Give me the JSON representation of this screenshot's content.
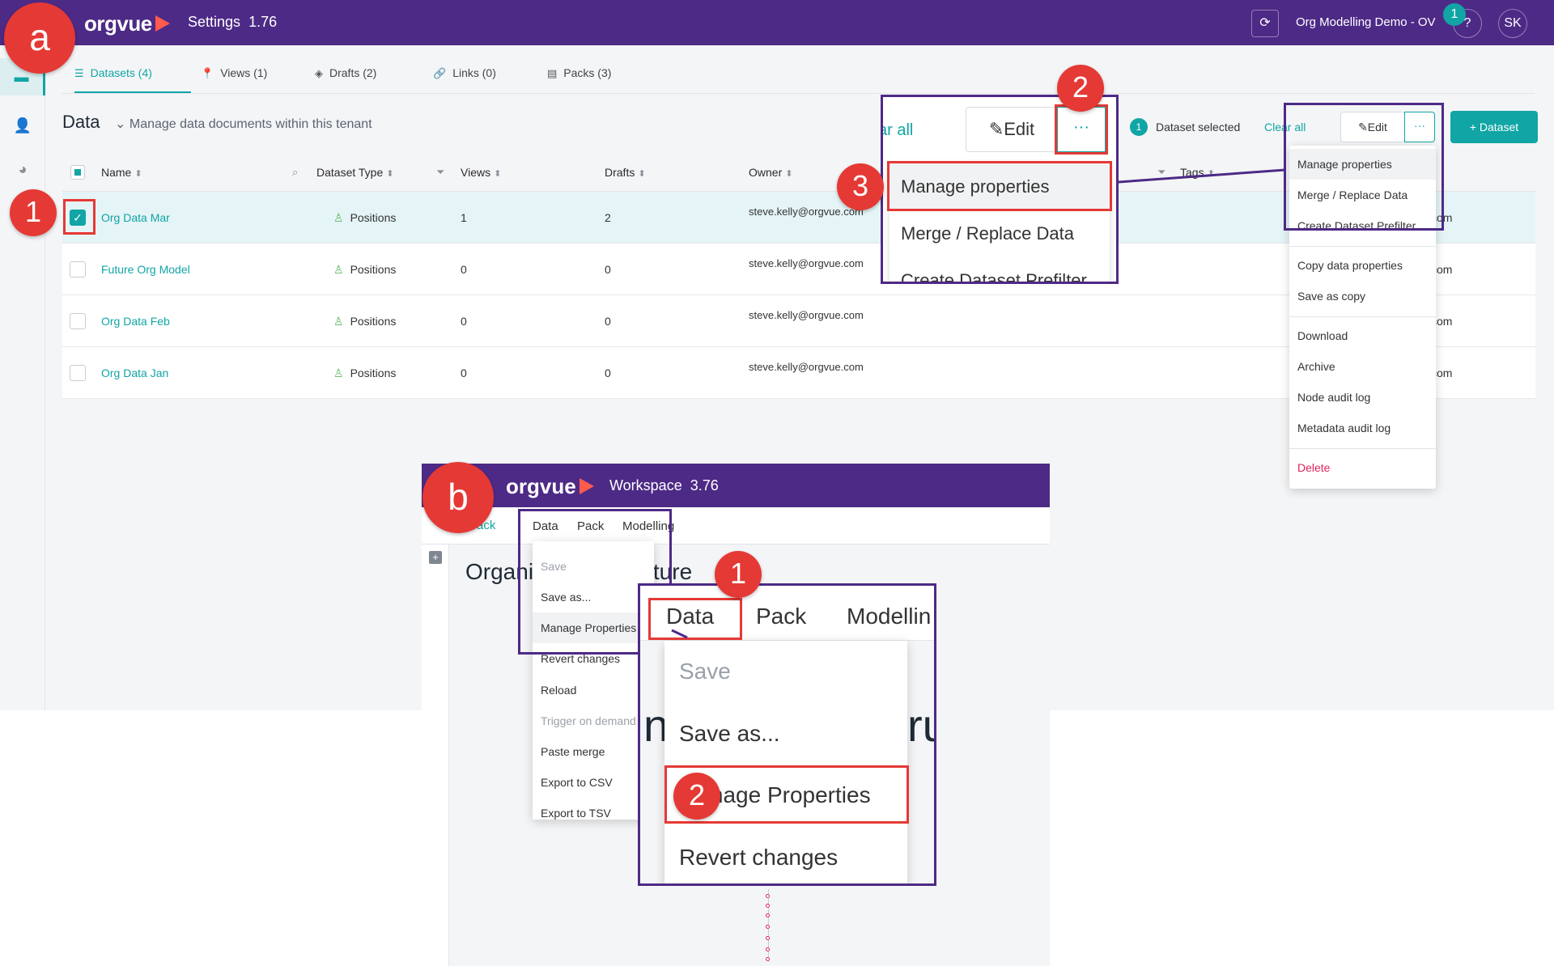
{
  "brand": {
    "name": "orgvue",
    "purple": "#4d2a86",
    "accent": "#11a5a5",
    "highlight": "#e53935"
  },
  "panel_a": {
    "app_title": "Settings",
    "version": "1.76",
    "org_name": "Org Modelling Demo - OV",
    "notification_count": "1",
    "help": "?",
    "avatar": "SK",
    "tabs": [
      {
        "label": "Datasets (4)",
        "icon": "database-icon"
      },
      {
        "label": "Views (1)",
        "icon": "pin-icon"
      },
      {
        "label": "Drafts (2)",
        "icon": "layers-icon"
      },
      {
        "label": "Links (0)",
        "icon": "link-icon"
      },
      {
        "label": "Packs (3)",
        "icon": "pack-icon"
      }
    ],
    "heading": "Data",
    "subheading": "Manage data documents within this tenant",
    "selection": {
      "count": "1",
      "text": "Dataset selected",
      "clear": "Clear all"
    },
    "edit_label": "Edit",
    "more_label": "···",
    "add_label": "+ Dataset",
    "columns": [
      "Name",
      "Dataset Type",
      "Views",
      "Drafts",
      "Owner",
      "Tags"
    ],
    "rows": [
      {
        "name": "Org Data Mar",
        "type": "Positions",
        "views": "1",
        "drafts": "2",
        "owner": "steve.kelly@orgvue.com",
        "tail": "com",
        "checked": true
      },
      {
        "name": "Future Org Model",
        "type": "Positions",
        "views": "0",
        "drafts": "0",
        "owner": "steve.kelly@orgvue.com",
        "tail": "com",
        "checked": false
      },
      {
        "name": "Org Data Feb",
        "type": "Positions",
        "views": "0",
        "drafts": "0",
        "owner": "steve.kelly@orgvue.com",
        "tail": "com",
        "checked": false
      },
      {
        "name": "Org Data Jan",
        "type": "Positions",
        "views": "0",
        "drafts": "0",
        "owner": "steve.kelly@orgvue.com",
        "tail": "com",
        "checked": false
      }
    ],
    "menu": {
      "group1": [
        "Manage properties",
        "Merge / Replace Data",
        "Create Dataset Prefilter"
      ],
      "group2": [
        "Copy data properties",
        "Save as copy"
      ],
      "group3": [
        "Download",
        "Archive",
        "Node audit log",
        "Metadata audit log"
      ],
      "delete": "Delete"
    },
    "zoom": {
      "clear_fragment": "ar all",
      "edit_label": "Edit",
      "more_label": "···",
      "items": [
        "Manage properties",
        "Merge / Replace Data",
        "Create Dataset Prefilter"
      ]
    }
  },
  "panel_b": {
    "app_title": "Workspace",
    "version": "3.76",
    "back": "Back",
    "menus": [
      "Data",
      "Pack",
      "Modelling"
    ],
    "title": "Organisation Structure",
    "dropdown": [
      {
        "label": "Save",
        "disabled": true
      },
      {
        "label": "Save as...",
        "disabled": false
      },
      {
        "label": "Manage Properties",
        "disabled": false
      },
      {
        "label": "Revert changes",
        "disabled": false
      },
      {
        "label": "Reload",
        "disabled": false
      },
      {
        "label": "Trigger on demand",
        "disabled": true
      },
      {
        "label": "Paste merge",
        "disabled": false
      },
      {
        "label": "Export to CSV",
        "disabled": false
      },
      {
        "label": "Export to TSV",
        "disabled": false
      }
    ],
    "zoom": {
      "menus": [
        "Data",
        "Pack",
        "Modellin"
      ],
      "items": [
        "Save",
        "Save as...",
        "Manage Properties",
        "Revert changes"
      ],
      "bg_left": "n",
      "bg_right": "ru"
    }
  },
  "markers": {
    "panel_a": "a",
    "panel_b": "b",
    "a_step1": "1",
    "a_step2": "2",
    "a_step3": "3",
    "b_step1": "1",
    "b_step2": "2"
  }
}
